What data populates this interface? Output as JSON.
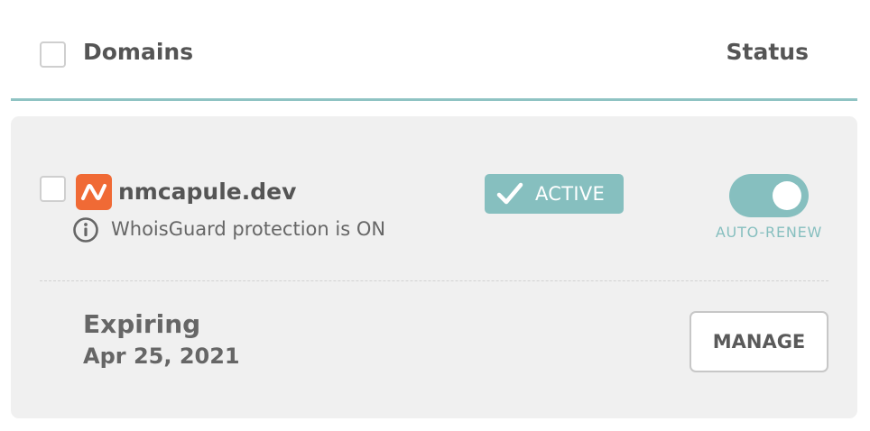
{
  "header": {
    "domains_label": "Domains",
    "status_label": "Status"
  },
  "domain": {
    "name": "nmcapule.dev",
    "whois_text": "WhoisGuard protection is ON",
    "status_badge": "ACTIVE",
    "auto_renew_label": "AUTO-RENEW",
    "auto_renew_on": true,
    "expiring_label": "Expiring",
    "expiring_date": "Apr 25, 2021",
    "manage_label": "MANAGE"
  },
  "colors": {
    "accent": "#86bfbf",
    "header_rule": "#8fc3c3",
    "brand_logo": "#f06a35",
    "card_bg": "#f0f0f0",
    "text_dark": "#555555"
  },
  "icons": {
    "brand": "namecheap-logo-icon",
    "info": "info-icon",
    "badge_check": "check-icon"
  }
}
